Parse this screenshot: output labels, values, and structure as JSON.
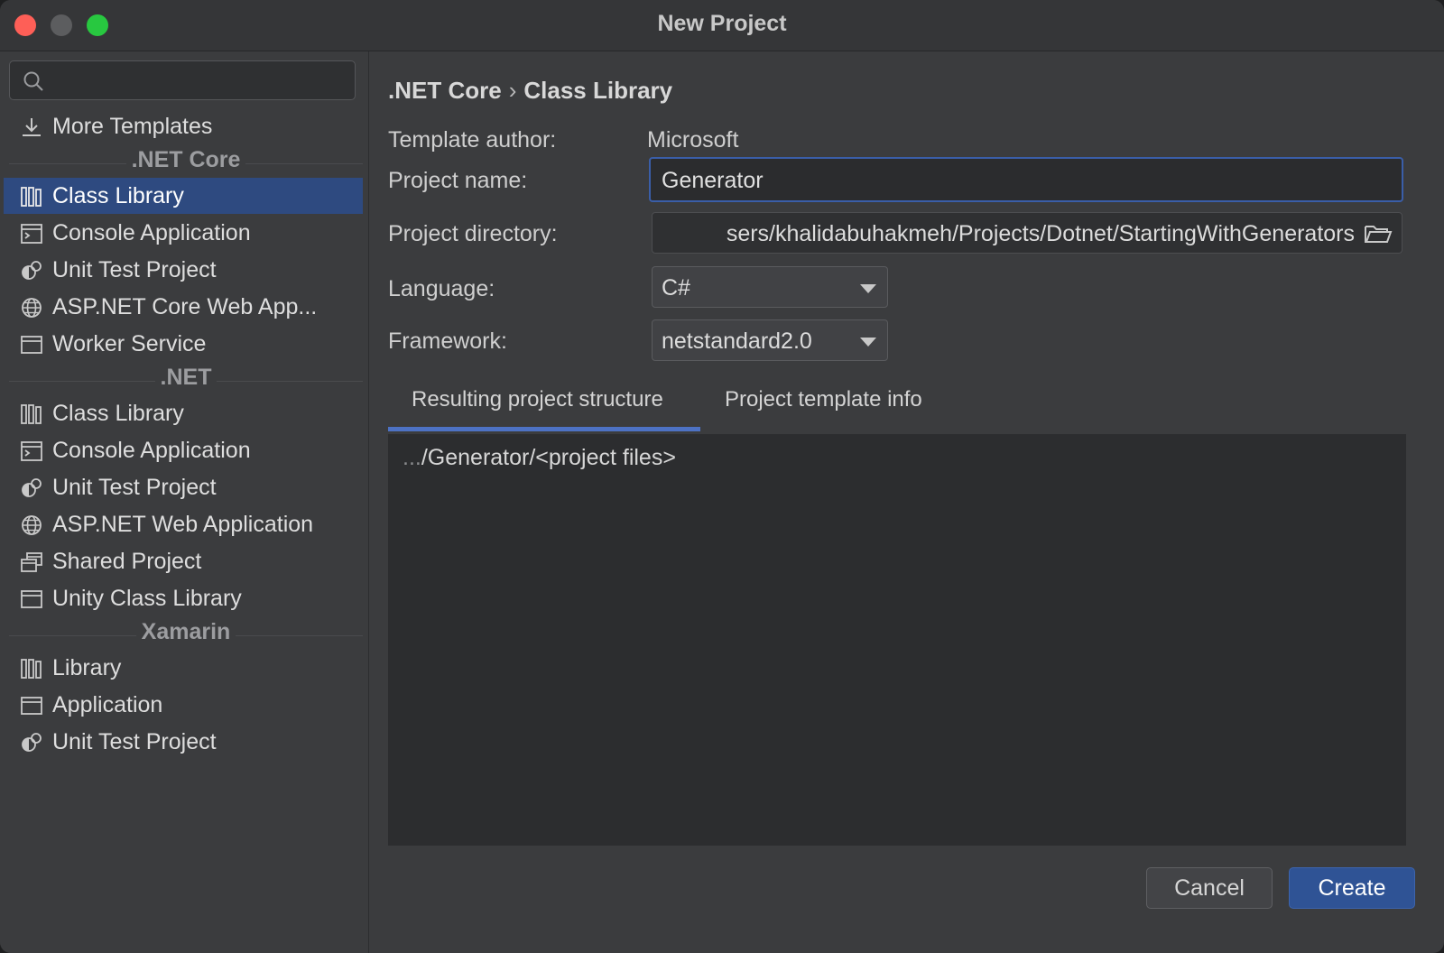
{
  "window": {
    "title": "New Project"
  },
  "sidebar": {
    "search_placeholder": "",
    "more_templates": "More Templates",
    "sections": [
      {
        "title": ".NET Core",
        "items": [
          {
            "label": "Class Library",
            "icon": "library-icon",
            "selected": true
          },
          {
            "label": "Console Application",
            "icon": "console-icon"
          },
          {
            "label": "Unit Test Project",
            "icon": "test-icon"
          },
          {
            "label": "ASP.NET Core Web App...",
            "icon": "globe-icon"
          },
          {
            "label": "Worker Service",
            "icon": "window-icon"
          }
        ]
      },
      {
        "title": ".NET",
        "items": [
          {
            "label": "Class Library",
            "icon": "library-icon"
          },
          {
            "label": "Console Application",
            "icon": "console-icon"
          },
          {
            "label": "Unit Test Project",
            "icon": "test-icon"
          },
          {
            "label": "ASP.NET Web Application",
            "icon": "globe-icon"
          },
          {
            "label": "Shared Project",
            "icon": "shared-icon"
          },
          {
            "label": "Unity Class Library",
            "icon": "window-icon"
          }
        ]
      },
      {
        "title": "Xamarin",
        "items": [
          {
            "label": "Library",
            "icon": "library-icon"
          },
          {
            "label": "Application",
            "icon": "window-icon"
          },
          {
            "label": "Unit Test Project",
            "icon": "test-icon"
          }
        ]
      }
    ]
  },
  "main": {
    "breadcrumb": {
      "parent": ".NET Core",
      "separator": "›",
      "current": "Class Library"
    },
    "template_author": {
      "label": "Template author:",
      "value": "Microsoft"
    },
    "project_name": {
      "label": "Project name:",
      "value": "Generator"
    },
    "project_directory": {
      "label": "Project directory:",
      "value": "sers/khalidabuhakmeh/Projects/Dotnet/StartingWithGenerators"
    },
    "language": {
      "label": "Language:",
      "value": "C#"
    },
    "framework": {
      "label": "Framework:",
      "value": "netstandard2.0"
    },
    "tabs": [
      {
        "label": "Resulting project structure",
        "active": true
      },
      {
        "label": "Project template info",
        "active": false
      }
    ],
    "structure": {
      "prefix": "...",
      "path": "/Generator/<project files>"
    }
  },
  "buttons": {
    "cancel": "Cancel",
    "create": "Create"
  },
  "colors": {
    "accent": "#2e4a80",
    "primary_button": "#2f5395",
    "focus_border": "#3a5ea8"
  }
}
